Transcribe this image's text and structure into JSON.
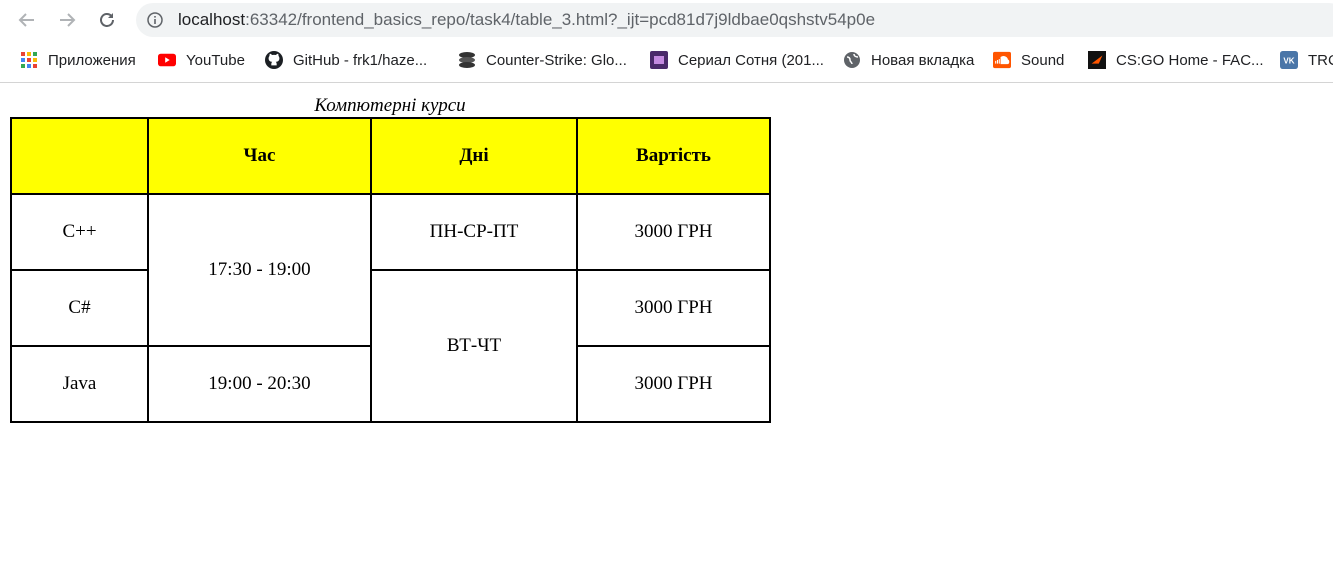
{
  "browser": {
    "url_host": "localhost",
    "url_rest": ":63342/frontend_basics_repo/task4/table_3.html?_ijt=pcd81d7j9ldbae0qshstv54p0e"
  },
  "bookmarks": [
    {
      "label": "Приложения"
    },
    {
      "label": "YouTube"
    },
    {
      "label": "GitHub - frk1/haze..."
    },
    {
      "label": "Counter-Strike: Glo..."
    },
    {
      "label": "Сериал Сотня (201..."
    },
    {
      "label": "Новая вкладка"
    },
    {
      "label": "Sound"
    },
    {
      "label": "CS:GO Home - FAC..."
    },
    {
      "label": "TRC"
    }
  ],
  "table": {
    "caption": "Компютерні курси",
    "headers": [
      "",
      "Час",
      "Дні",
      "Вартість"
    ],
    "rows": [
      {
        "course": "C++",
        "time": "17:30 - 19:00",
        "days": "ПН-СР-ПТ",
        "price": "3000 ГРН"
      },
      {
        "course": "C#",
        "price": "3000 ГРН"
      },
      {
        "course": "Java",
        "time": "19:00 - 20:30",
        "days": "ВТ-ЧТ",
        "price": "3000 ГРН"
      }
    ]
  }
}
